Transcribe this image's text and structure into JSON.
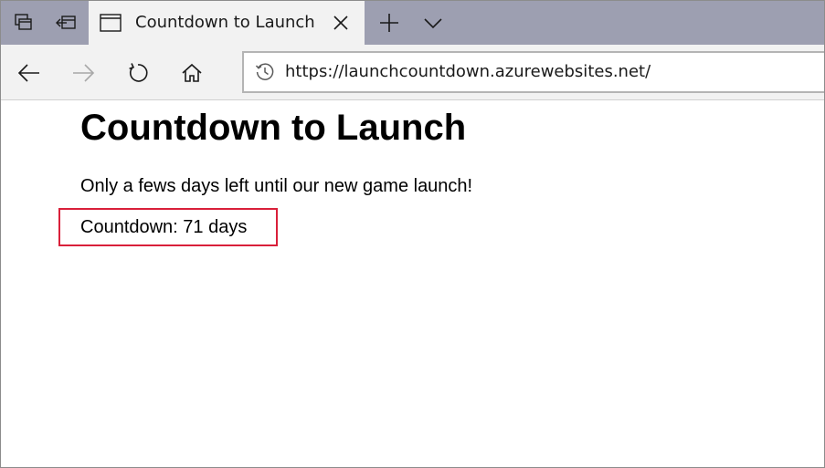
{
  "browser": {
    "tab": {
      "title": "Countdown to Launch"
    },
    "address_bar": {
      "url": "https://launchcountdown.azurewebsites.net/"
    },
    "icons": {
      "set_aside_tabs": "tabs-stack-icon",
      "tabs_aside": "tabs-aside-icon",
      "page": "page-icon",
      "close": "close-icon",
      "new_tab": "plus-icon",
      "tab_overflow": "chevron-down-icon",
      "back": "arrow-left-icon",
      "forward": "arrow-right-icon",
      "refresh": "refresh-icon",
      "home": "home-icon",
      "history": "history-icon"
    },
    "colors": {
      "tab_strip": "#9d9fb1",
      "active_tab": "#f2f2f2",
      "highlight": "#d9203a"
    }
  },
  "page": {
    "heading": "Countdown to Launch",
    "subtitle": "Only a fews days left until our new game launch!",
    "countdown": "Countdown: 71 days"
  }
}
